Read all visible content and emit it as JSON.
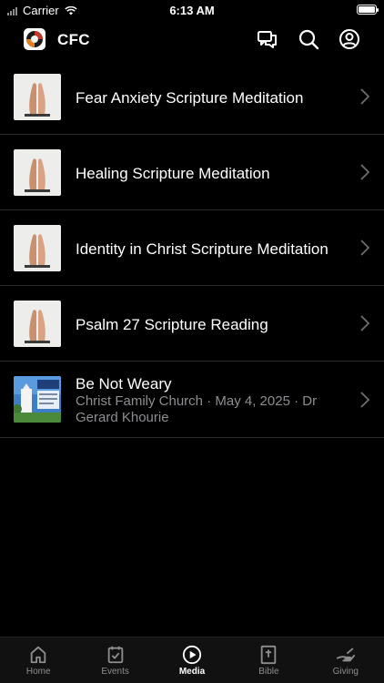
{
  "status_bar": {
    "carrier": "Carrier",
    "time": "6:13 AM"
  },
  "header": {
    "title": "CFC"
  },
  "media_items": [
    {
      "title": "Fear Anxiety Scripture Meditation"
    },
    {
      "title": "Healing Scripture Meditation"
    },
    {
      "title": "Identity in Christ Scripture Meditation"
    },
    {
      "title": "Psalm 27 Scripture Reading"
    },
    {
      "title": "Be Not Weary",
      "subtitle": "Christ Family Church · May 4, 2025 · Dr Gerard Khourie"
    }
  ],
  "tabs": [
    {
      "label": "Home",
      "icon": "home-icon"
    },
    {
      "label": "Events",
      "icon": "events-icon"
    },
    {
      "label": "Media",
      "icon": "media-icon",
      "active": true
    },
    {
      "label": "Bible",
      "icon": "bible-icon"
    },
    {
      "label": "Giving",
      "icon": "giving-icon"
    }
  ]
}
